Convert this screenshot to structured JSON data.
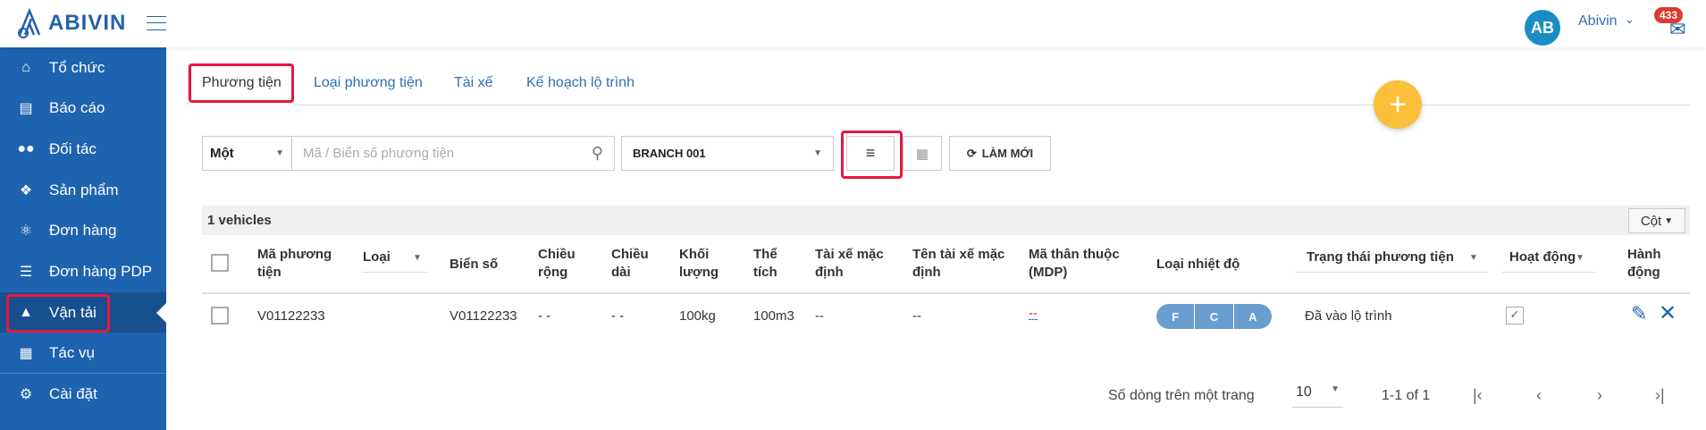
{
  "header": {
    "logo": "ABIVIN",
    "avatar_initials": "AB",
    "user_name": "Abivin",
    "notification_count": "433"
  },
  "sidebar": {
    "items": [
      {
        "label": "Tổ chức",
        "icon": "home-icon"
      },
      {
        "label": "Báo cáo",
        "icon": "bar-chart-icon"
      },
      {
        "label": "Đối tác",
        "icon": "users-icon"
      },
      {
        "label": "Sản phẩm",
        "icon": "dropbox-icon"
      },
      {
        "label": "Đơn hàng",
        "icon": "cubes-icon"
      },
      {
        "label": "Đơn hàng PDP",
        "icon": "list-icon"
      },
      {
        "label": "Vận tải",
        "icon": "road-icon",
        "active": true
      },
      {
        "label": "Tác vụ",
        "icon": "calendar-icon"
      },
      {
        "label": "Cài đặt",
        "icon": "gear-icon"
      }
    ]
  },
  "tabs": [
    {
      "label": "Phương tiện",
      "active": true
    },
    {
      "label": "Loại phương tiện"
    },
    {
      "label": "Tài xế"
    },
    {
      "label": "Kế hoạch lộ trình"
    }
  ],
  "filters": {
    "mode": "Một",
    "search_placeholder": "Mã / Biển số phương tiện",
    "branch": "BRANCH 001",
    "refresh_label": "LÀM MỚI"
  },
  "table": {
    "count_label": "1 vehicles",
    "columns_button": "Cột",
    "headers": [
      "Mã phương tiện",
      "Loại",
      "Biển số",
      "Chiều rộng",
      "Chiều dài",
      "Khối lượng",
      "Thể tích",
      "Tài xế mặc định",
      "Tên tài xế mặc định",
      "Mã thân thuộc (MDP)",
      "Loại nhiệt độ",
      "Trạng thái phương tiện",
      "Hoạt động",
      "Hành động"
    ],
    "rows": [
      {
        "code": "V01122233",
        "type": "",
        "plate": "V01122233",
        "width": "- -",
        "length": "- -",
        "weight": "100kg",
        "volume": "100m3",
        "default_driver": "--",
        "default_driver_name": "--",
        "mdp": "--",
        "temps": [
          "F",
          "C",
          "A"
        ],
        "status": "Đã vào lộ trình",
        "active": true
      }
    ]
  },
  "pagination": {
    "rows_per_page_label": "Số dòng trên một trang",
    "rows_per_page": "10",
    "range": "1-1 of 1"
  },
  "colors": {
    "sidebar": "#1e63b0",
    "sidebar_active": "#184f8f",
    "fab": "#fbbf3a",
    "highlight": "#e8173f",
    "badge": "#d93c30"
  }
}
